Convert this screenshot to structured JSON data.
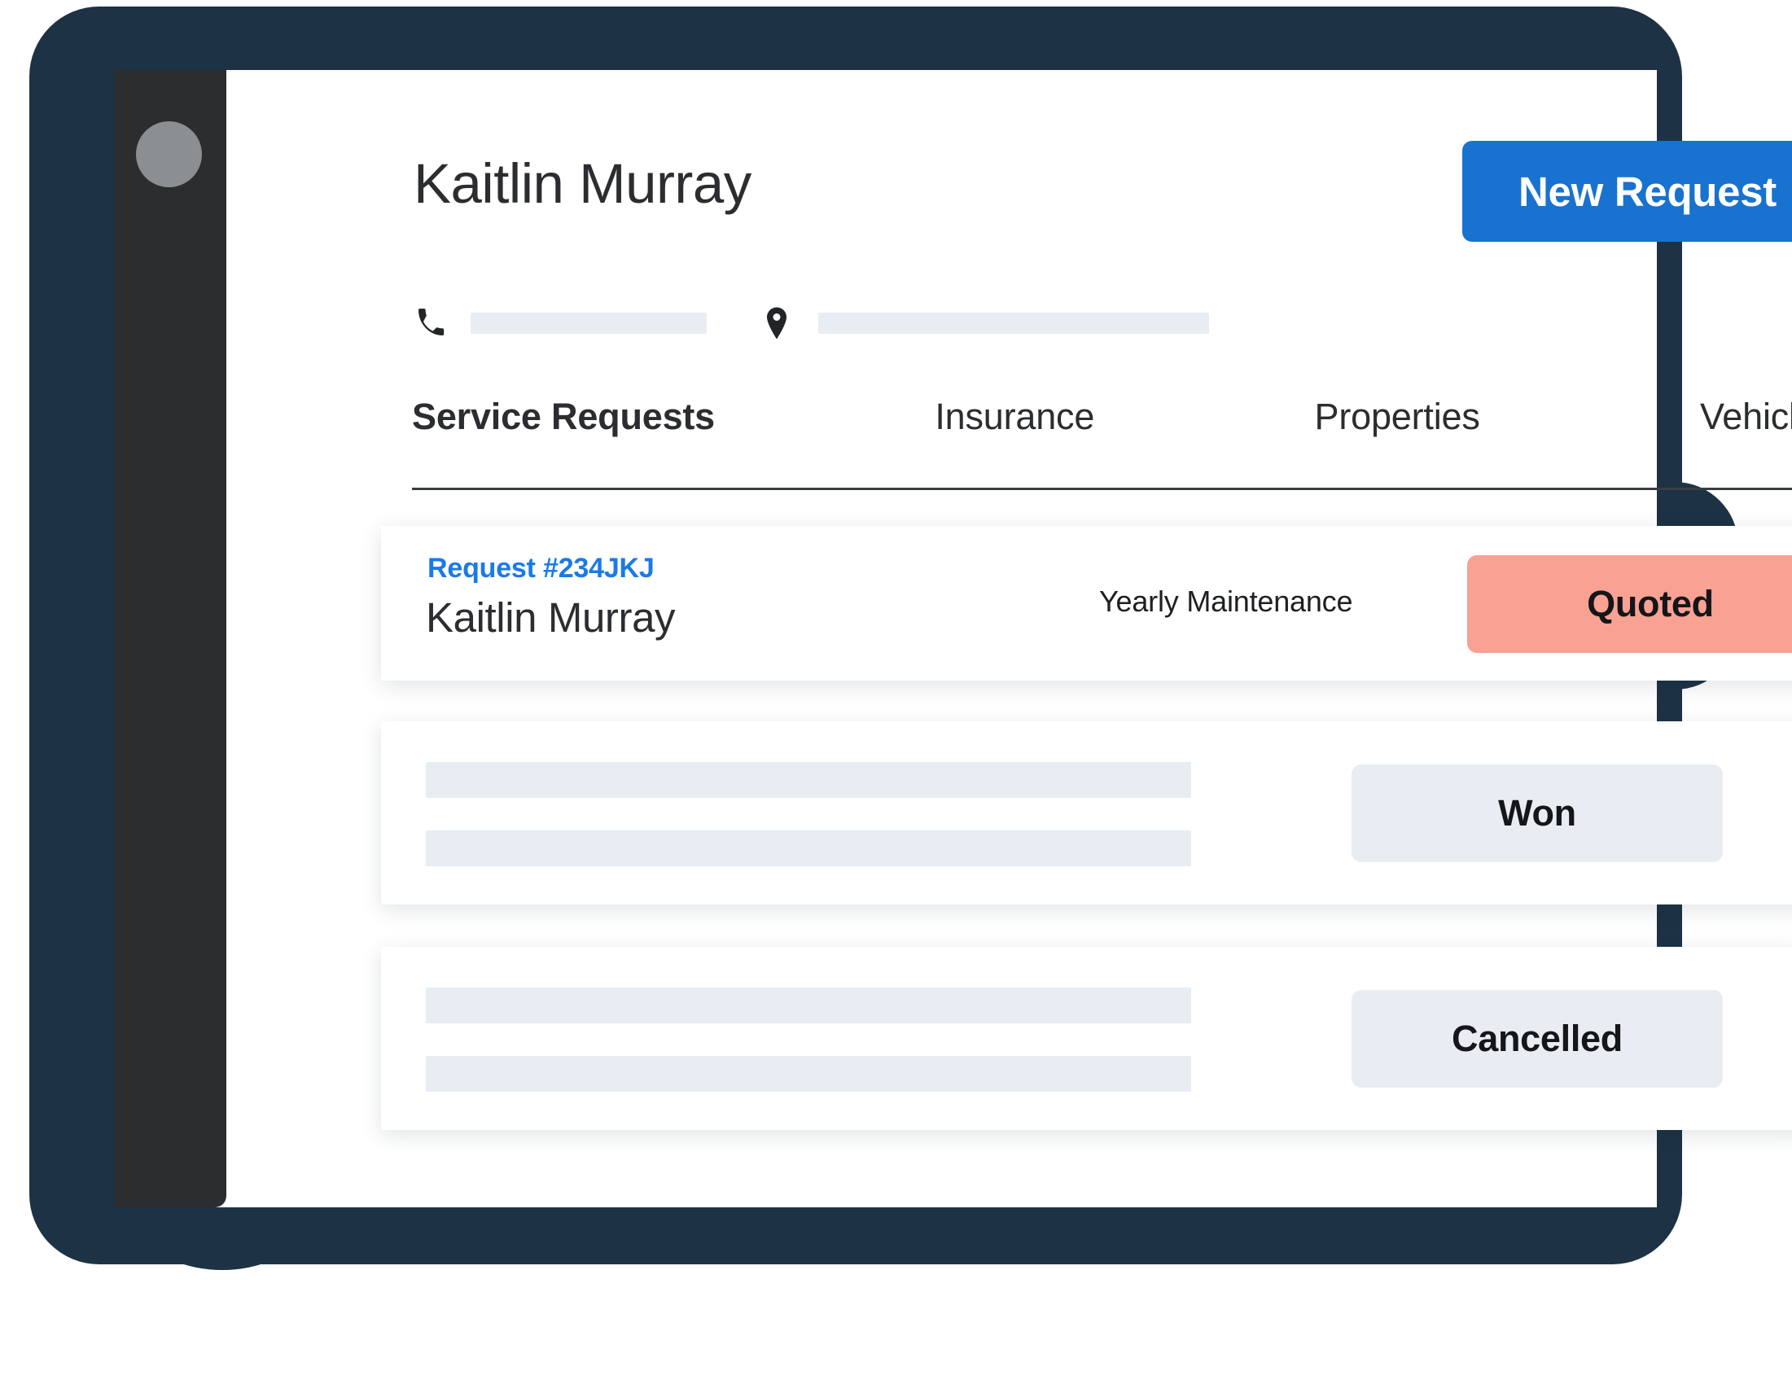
{
  "theme": {
    "frame_color": "#1d3244",
    "sidebar_color": "#2b2d2f",
    "accent_blue": "#1872cf",
    "link_blue": "#1a7ae8",
    "badge_quoted_bg": "#f9a193",
    "badge_neutral_bg": "#e9edf3",
    "skeleton_color": "#e8edf3"
  },
  "sidebar": {
    "avatar_name": "avatar"
  },
  "header": {
    "title": "Kaitlin Murray",
    "new_request_label": "New Request",
    "contact": {
      "phone_icon": "phone-icon",
      "location_icon": "location-pin-icon",
      "phone_value": "",
      "address_value": ""
    }
  },
  "tabs": [
    {
      "label": "Service Requests",
      "active": true
    },
    {
      "label": "Insurance",
      "active": false
    },
    {
      "label": "Properties",
      "active": false
    },
    {
      "label": "Vehicles",
      "active": false
    }
  ],
  "requests": [
    {
      "request_id": "Request #234JKJ",
      "customer": "Kaitlin Murray",
      "service": "Yearly Maintenance",
      "status": "Quoted",
      "status_style": "quoted",
      "placeholder": false
    },
    {
      "request_id": "",
      "customer": "",
      "service": "",
      "status": "Won",
      "status_style": "neutral",
      "placeholder": true
    },
    {
      "request_id": "",
      "customer": "",
      "service": "",
      "status": "Cancelled",
      "status_style": "neutral",
      "placeholder": true
    }
  ]
}
